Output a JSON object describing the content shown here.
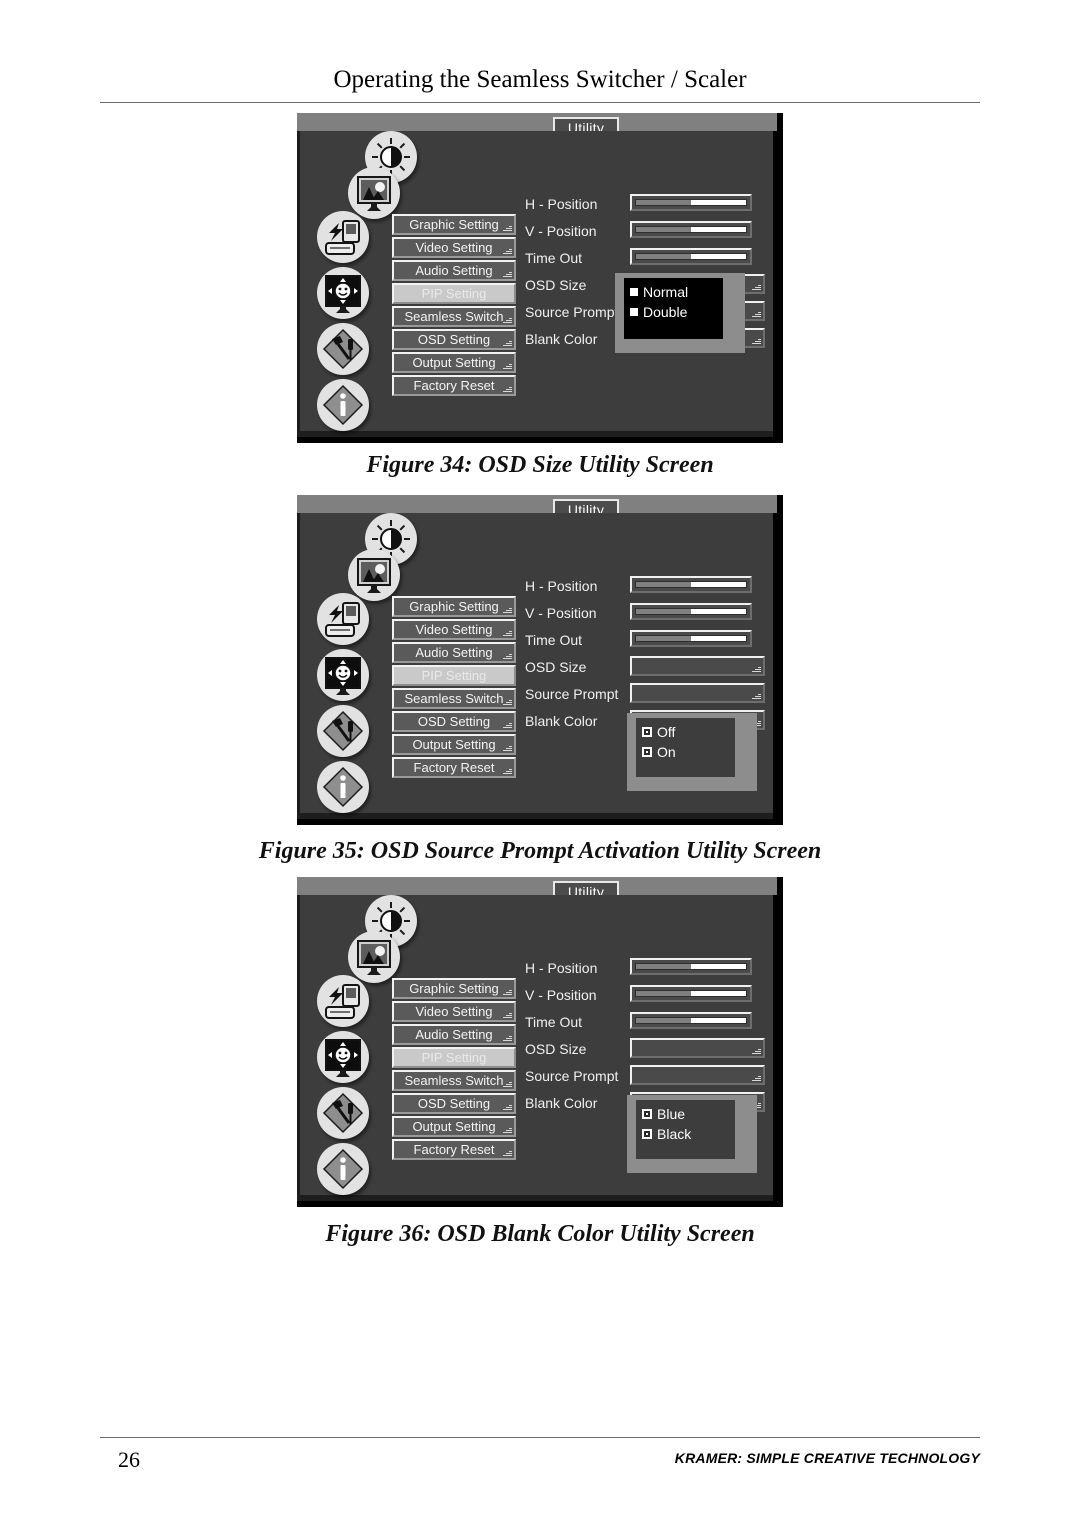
{
  "page": {
    "header_title": "Operating the Seamless Switcher / Scaler",
    "footer_page_number": "26",
    "footer_brand": "KRAMER: SIMPLE CREATIVE TECHNOLOGY"
  },
  "osd_common": {
    "tab_label": "Utility",
    "icons": [
      "brightness-contrast-icon",
      "picture-monitor-icon",
      "input-source-icon",
      "pip-face-icon",
      "tools-icon",
      "info-icon"
    ],
    "menu_items": [
      "Graphic Setting",
      "Video Setting",
      "Audio Setting",
      "PIP Setting",
      "Seamless Switch",
      "OSD Setting",
      "Output Setting",
      "Factory Reset"
    ],
    "selected_menu_item": "PIP Setting",
    "settings": [
      {
        "label": "H - Position",
        "control": "slider",
        "fill_percent": 50
      },
      {
        "label": "V - Position",
        "control": "slider",
        "fill_percent": 50
      },
      {
        "label": "Time Out",
        "control": "slider",
        "fill_percent": 50
      },
      {
        "label": "OSD Size",
        "control": "combo",
        "value": ""
      },
      {
        "label": "Source Prompt",
        "control": "combo",
        "value": ""
      },
      {
        "label": "Blank Color",
        "control": "combo",
        "value": ""
      }
    ],
    "colors": {
      "panel_background": "#3d3d3d",
      "titlebar": "#808080",
      "menu_button": "#5a5a5a",
      "menu_button_selected": "#c9c9c9",
      "text": "#f0f0f0"
    }
  },
  "figures": [
    {
      "caption": "Figure 34: OSD Size Utility Screen",
      "open_dropdown": {
        "anchor": "OSD Size",
        "style": "dark",
        "options": [
          "Normal",
          "Double"
        ]
      }
    },
    {
      "caption": "Figure 35: OSD Source Prompt Activation Utility Screen",
      "open_dropdown": {
        "anchor": "Blank Color",
        "style": "mid",
        "options": [
          "Off",
          "On"
        ]
      }
    },
    {
      "caption": "Figure 36: OSD Blank Color Utility Screen",
      "open_dropdown": {
        "anchor": "Blank Color",
        "style": "mid",
        "options": [
          "Blue",
          "Black"
        ]
      }
    }
  ]
}
